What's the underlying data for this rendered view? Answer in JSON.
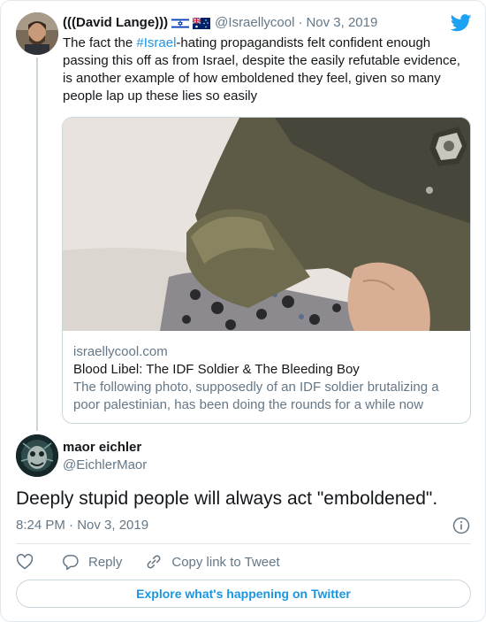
{
  "parent_tweet": {
    "name": "(((David Lange)))",
    "handle": "@Israellycool",
    "separator": "·",
    "date": "Nov 3, 2019",
    "text_before": "The fact the ",
    "hashtag": "#Israel",
    "text_after": "-hating propagandists felt confident enough passing this off as from Israel, despite the easily refutable evidence, is another example of how emboldened they feel, given so many people lap up these lies so easily",
    "flags": [
      "israel-flag-icon",
      "australia-flag-icon"
    ]
  },
  "link_card": {
    "domain": "israellycool.com",
    "title": "Blood Libel: The IDF Soldier & The Bleeding Boy",
    "description": "The following photo, supposedly of an IDF soldier brutalizing a poor palestinian, has been doing the rounds for a while now"
  },
  "reply_tweet": {
    "name": "maor eichler",
    "handle": "@EichlerMaor",
    "text": "Deeply stupid people will always act \"emboldened\".",
    "timestamp": "8:24 PM · Nov 3, 2019"
  },
  "actions": {
    "reply_label": "Reply",
    "copy_link_label": "Copy link to Tweet"
  },
  "explore_label": "Explore what's happening on Twitter",
  "colors": {
    "link": "#1b95e0",
    "twitter_blue": "#1da1f2",
    "secondary_text": "#657786"
  }
}
